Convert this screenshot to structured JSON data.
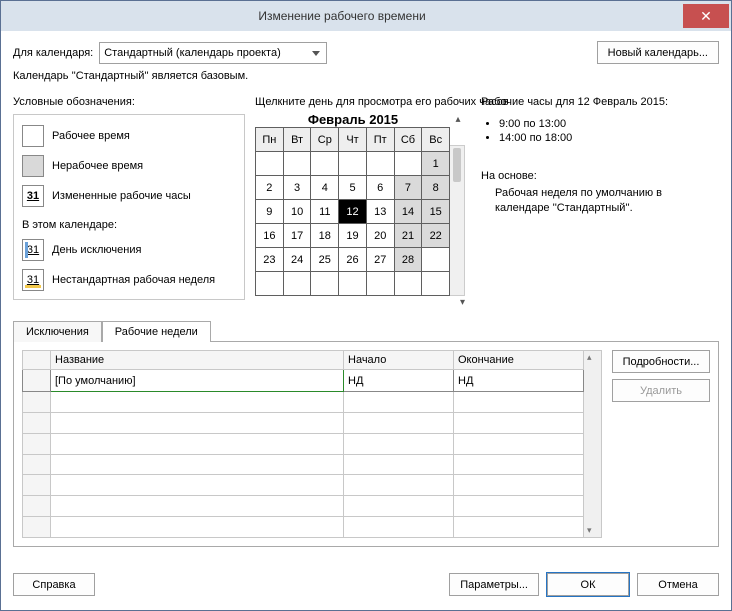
{
  "titlebar": {
    "title": "Изменение рабочего времени"
  },
  "header": {
    "calendar_label": "Для календаря:",
    "calendar_value": "Стандартный (календарь проекта)",
    "new_calendar_btn": "Новый календарь...",
    "base_text": "Календарь ''Стандартный'' является базовым."
  },
  "legend": {
    "title": "Условные обозначения:",
    "work": "Рабочее время",
    "nonwork": "Нерабочее время",
    "changed_symbol": "31",
    "changed": "Измененные рабочие часы",
    "subtitle": "В этом календаре:",
    "exc_symbol": "31",
    "exc": "День исключения",
    "nsw_symbol": "31",
    "nsw": "Нестандартная рабочая неделя"
  },
  "calendar": {
    "instruction": "Щелкните день для просмотра его рабочих часов",
    "title": "Февраль 2015",
    "dow": [
      "Пн",
      "Вт",
      "Ср",
      "Чт",
      "Пт",
      "Сб",
      "Вс"
    ],
    "weeks": [
      [
        {
          "v": "",
          "t": "blank"
        },
        {
          "v": "",
          "t": "blank"
        },
        {
          "v": "",
          "t": "blank"
        },
        {
          "v": "",
          "t": "blank"
        },
        {
          "v": "",
          "t": "blank"
        },
        {
          "v": "",
          "t": "blank"
        },
        {
          "v": "1",
          "t": "wknd"
        }
      ],
      [
        {
          "v": "2",
          "t": "day"
        },
        {
          "v": "3",
          "t": "day"
        },
        {
          "v": "4",
          "t": "day"
        },
        {
          "v": "5",
          "t": "day"
        },
        {
          "v": "6",
          "t": "day"
        },
        {
          "v": "7",
          "t": "wknd"
        },
        {
          "v": "8",
          "t": "wknd"
        }
      ],
      [
        {
          "v": "9",
          "t": "day"
        },
        {
          "v": "10",
          "t": "day"
        },
        {
          "v": "11",
          "t": "day"
        },
        {
          "v": "12",
          "t": "sel"
        },
        {
          "v": "13",
          "t": "day"
        },
        {
          "v": "14",
          "t": "wknd"
        },
        {
          "v": "15",
          "t": "wknd"
        }
      ],
      [
        {
          "v": "16",
          "t": "day"
        },
        {
          "v": "17",
          "t": "day"
        },
        {
          "v": "18",
          "t": "day"
        },
        {
          "v": "19",
          "t": "day"
        },
        {
          "v": "20",
          "t": "day"
        },
        {
          "v": "21",
          "t": "wknd"
        },
        {
          "v": "22",
          "t": "wknd"
        }
      ],
      [
        {
          "v": "23",
          "t": "day"
        },
        {
          "v": "24",
          "t": "day"
        },
        {
          "v": "25",
          "t": "day"
        },
        {
          "v": "26",
          "t": "day"
        },
        {
          "v": "27",
          "t": "day"
        },
        {
          "v": "28",
          "t": "wknd"
        },
        {
          "v": "",
          "t": "blank"
        }
      ],
      [
        {
          "v": "",
          "t": "blank"
        },
        {
          "v": "",
          "t": "blank"
        },
        {
          "v": "",
          "t": "blank"
        },
        {
          "v": "",
          "t": "blank"
        },
        {
          "v": "",
          "t": "blank"
        },
        {
          "v": "",
          "t": "blank"
        },
        {
          "v": "",
          "t": "blank"
        }
      ]
    ]
  },
  "info": {
    "title": "Рабочие часы для 12 Февраль 2015:",
    "hours": [
      "9:00 по 13:00",
      "14:00 по 18:00"
    ],
    "basis_title": "На основе:",
    "basis_text": "Рабочая неделя по умолчанию в календаре ''Стандартный''."
  },
  "tabs": {
    "exceptions": "Исключения",
    "workweeks": "Рабочие недели"
  },
  "grid": {
    "col_name": "Название",
    "col_start": "Начало",
    "col_end": "Окончание",
    "row": {
      "name": "[По умолчанию]",
      "start": "НД",
      "end": "НД"
    }
  },
  "side": {
    "details": "Подробности...",
    "delete": "Удалить"
  },
  "footer": {
    "help": "Справка",
    "options": "Параметры...",
    "ok": "ОК",
    "cancel": "Отмена"
  }
}
